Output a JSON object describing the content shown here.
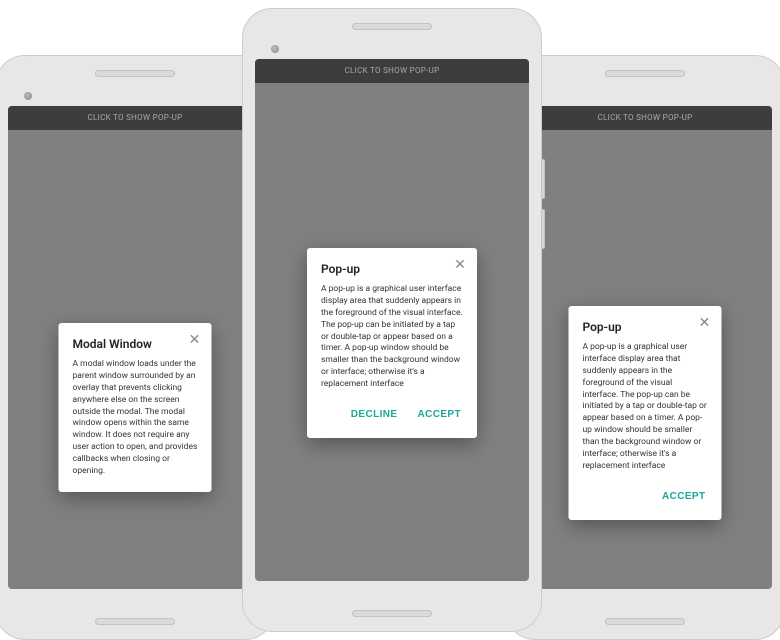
{
  "topbar": {
    "label": "CLICK TO SHOW POP-UP"
  },
  "phones": {
    "left": {
      "card": {
        "title": "Modal Window",
        "body": "A modal window loads under the parent window surrounded by an overlay that prevents clicking anywhere else on the screen outside the modal. The modal window opens within the same window. It does not require any user action to open, and provides callbacks when closing or opening."
      }
    },
    "center": {
      "card": {
        "title": "Pop-up",
        "body": "A pop-up is a graphical user interface display area that suddenly appears in the foreground of the visual interface. The pop-up can be initiated by a tap or double-tap or appear based on a timer. A pop-up window should be smaller than the background window or interface; otherwise it's a replacement interface",
        "decline": "DECLINE",
        "accept": "ACCEPT"
      }
    },
    "right": {
      "card": {
        "title": "Pop-up",
        "body": "A pop-up is a graphical user interface display area that suddenly appears in the foreground of the visual interface. The pop-up can be initiated by a tap or double-tap or appear based on a timer. A pop-up window should be smaller than the background window or interface; otherwise it's a replacement interface",
        "accept": "ACCEPT"
      }
    }
  },
  "colors": {
    "accent": "#1aa99b"
  }
}
